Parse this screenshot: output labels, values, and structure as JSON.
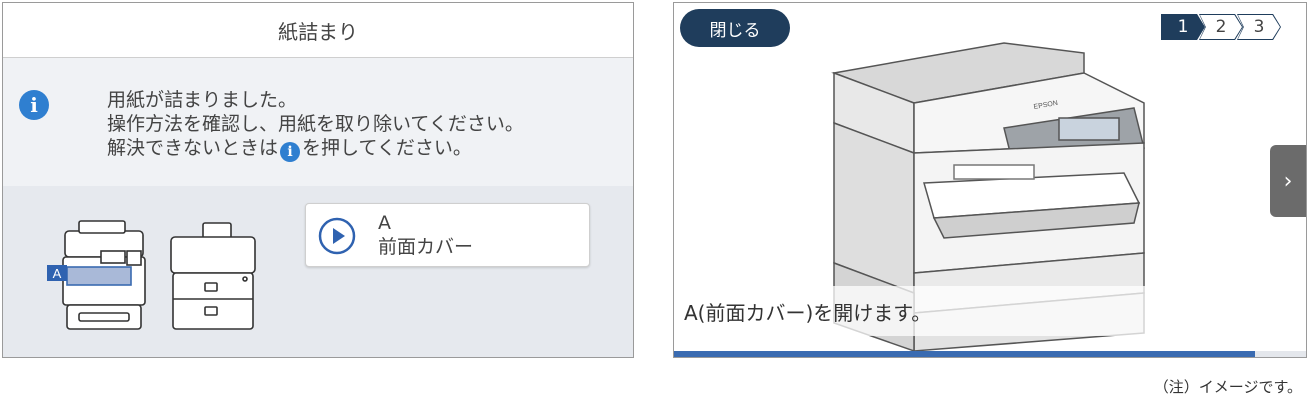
{
  "left": {
    "title": "紙詰まり",
    "message": {
      "line1": "用紙が詰まりました。",
      "line2": "操作方法を確認し、用紙を取り除いてください。",
      "line3_before": "解決できないときは",
      "line3_after": "を押してください。"
    },
    "thumb_label": "A",
    "guide_button": {
      "line1": "A",
      "line2": "前面カバー"
    },
    "icons": [
      "info-icon",
      "play-icon",
      "printer-front-icon",
      "printer-rear-icon"
    ]
  },
  "right": {
    "close_label": "閉じる",
    "steps": [
      "1",
      "2",
      "3"
    ],
    "active_step": 1,
    "caption": "A(前面カバー)を開けます。",
    "next_symbol": "›",
    "progress": 0.92,
    "accent_color": "#1f3d5c",
    "progress_color": "#3a6bb1"
  },
  "note": "（注）イメージです。"
}
